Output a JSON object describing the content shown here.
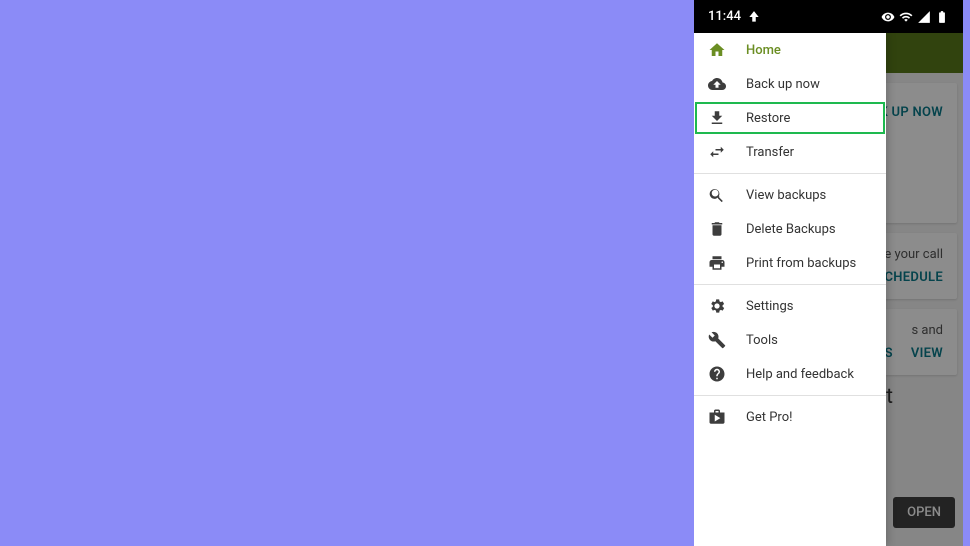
{
  "status": {
    "time": "11:44"
  },
  "drawer": {
    "items": [
      {
        "label": "Home"
      },
      {
        "label": "Back up now"
      },
      {
        "label": "Restore"
      },
      {
        "label": "Transfer"
      },
      {
        "label": "View backups"
      },
      {
        "label": "Delete Backups"
      },
      {
        "label": "Print from backups"
      },
      {
        "label": "Settings"
      },
      {
        "label": "Tools"
      },
      {
        "label": "Help and feedback"
      },
      {
        "label": "Get Pro!"
      }
    ]
  },
  "background": {
    "backup_btn": "CK UP NOW",
    "schedule_text": "nsure your call",
    "schedule_btn": "SCHEDULE",
    "view_text": "s and",
    "dismiss": "SS",
    "view": "VIEW",
    "ot_title": "ot",
    "open": "OPEN"
  }
}
